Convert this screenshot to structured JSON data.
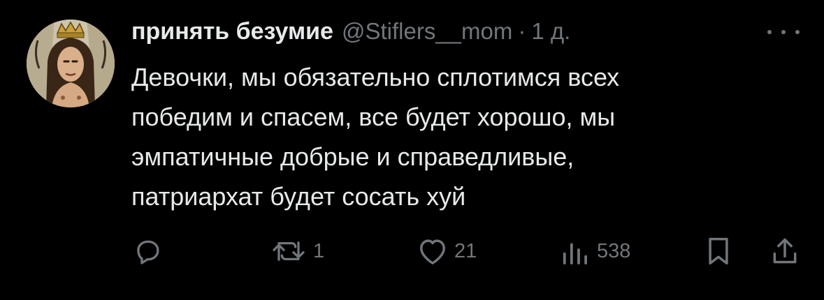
{
  "tweet": {
    "author": {
      "display_name": "принять безумие",
      "handle": "@Stiflers__mom",
      "avatar_icon": "avatar-illustration-crowned-woman"
    },
    "separator": "·",
    "time": "1 д.",
    "more_icon": "more-options-icon",
    "text": "Девочки, мы обязательно сплотимся всех\nпобедим и спасем, все будет хорошо, мы\nэмпатичные добрые и справедливые,\nпатриархат будет сосать хуй",
    "actions": {
      "reply": {
        "icon": "reply-icon"
      },
      "retweet": {
        "icon": "retweet-icon",
        "count": "1"
      },
      "like": {
        "icon": "heart-icon",
        "count": "21"
      },
      "views": {
        "icon": "views-icon",
        "count": "538"
      },
      "bookmark": {
        "icon": "bookmark-icon"
      },
      "share": {
        "icon": "share-icon"
      }
    }
  },
  "colors": {
    "background": "#000000",
    "primary_text": "#e7e9ea",
    "secondary_text": "#71767b"
  }
}
